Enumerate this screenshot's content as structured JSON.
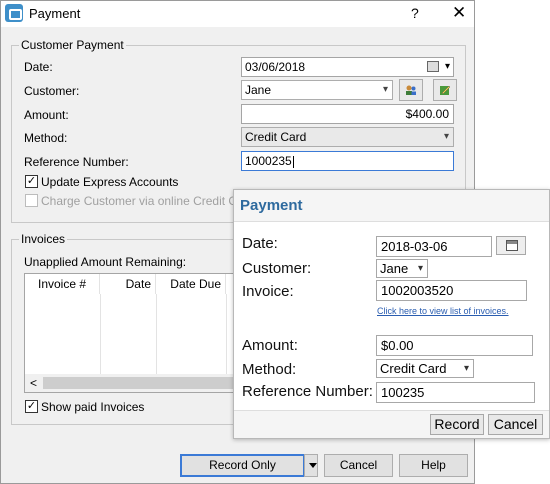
{
  "window": {
    "title": "Payment",
    "help_glyph": "?",
    "close_glyph": "✕"
  },
  "customer_payment": {
    "group_label": "Customer Payment",
    "date_label": "Date:",
    "date_value": "03/06/2018",
    "customer_label": "Customer:",
    "customer_value": "Jane",
    "amount_label": "Amount:",
    "amount_value": "$400.00",
    "method_label": "Method:",
    "method_value": "Credit Card",
    "reference_label": "Reference Number:",
    "reference_value": "1000235",
    "update_accounts_label": "Update Express Accounts",
    "update_accounts_checked": true,
    "charge_online_label": "Charge Customer via online Credit Card Ga",
    "charge_online_checked": false
  },
  "invoices": {
    "group_label": "Invoices",
    "unapplied_label": "Unapplied Amount Remaining:",
    "columns": [
      "Invoice #",
      "Date",
      "Date Due"
    ],
    "scroll_left_glyph": "<",
    "show_paid_label": "Show paid Invoices",
    "show_paid_checked": true
  },
  "footer": {
    "record_only_label": "Record Only",
    "cancel_label": "Cancel",
    "help_label": "Help"
  },
  "card": {
    "title": "Payment",
    "date_label": "Date:",
    "date_value": "2018-03-06",
    "customer_label": "Customer:",
    "customer_value": "Jane",
    "invoice_label": "Invoice:",
    "invoice_value": "1002003520",
    "invoice_link": "Click here to view list of invoices.",
    "amount_label": "Amount:",
    "amount_value": "$0.00",
    "method_label": "Method:",
    "method_value": "Credit Card",
    "reference_label": "Reference Number:",
    "reference_value": "100235",
    "record_label": "Record",
    "cancel_label": "Cancel"
  },
  "icons": {
    "app": "payment-app-icon",
    "calendar": "calendar-icon",
    "customer_lookup": "customer-lookup-icon",
    "edit": "edit-icon",
    "check": "✓",
    "dropdown": "▾"
  },
  "colors": {
    "accent_blue": "#3b7ad6",
    "card_title": "#2e6a9e",
    "link": "#2a5db0"
  }
}
